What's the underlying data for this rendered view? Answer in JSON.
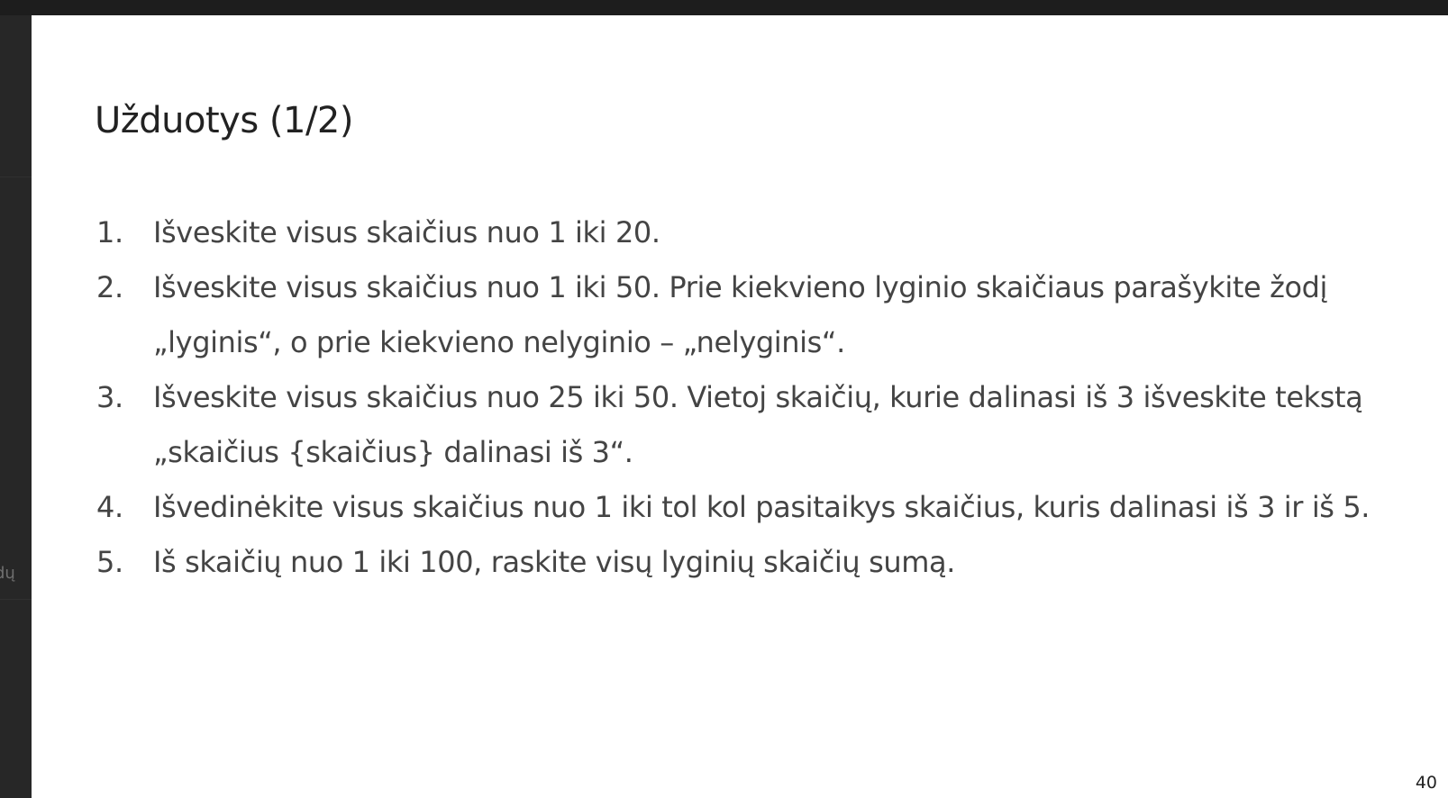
{
  "sidebar": {
    "partial_label": "dų"
  },
  "slide": {
    "title": "Užduotys (1/2)",
    "tasks": [
      {
        "number": "1.",
        "text": "Išveskite visus skaičius nuo 1 iki 20."
      },
      {
        "number": "2.",
        "text": "Išveskite visus skaičius nuo 1 iki 50. Prie kiekvieno lyginio skaičiaus parašykite žodį „lyginis“, o prie kiekvieno nelyginio – „nelyginis“."
      },
      {
        "number": "3.",
        "text": "Išveskite visus skaičius nuo 25 iki 50. Vietoj skaičių, kurie dalinasi iš 3 išveskite tekstą „skaičius {skaičius} dalinasi iš 3“."
      },
      {
        "number": "4.",
        "text": "Išvedinėkite visus skaičius nuo 1 iki tol kol pasitaikys skaičius, kuris dalinasi iš 3 ir iš 5."
      },
      {
        "number": "5.",
        "text": "Iš skaičių nuo 1 iki 100, raskite visų lyginių skaičių sumą."
      }
    ],
    "page_number": "40"
  }
}
